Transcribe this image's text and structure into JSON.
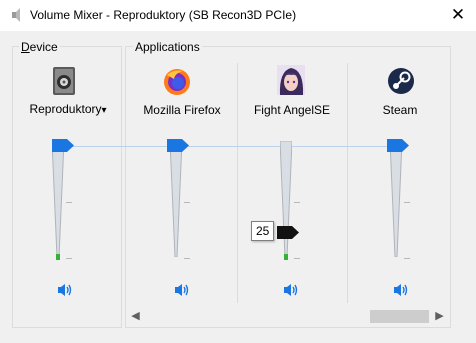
{
  "window": {
    "title": "Volume Mixer - Reproduktory (SB Recon3D PCIe)",
    "close_glyph": "✕",
    "icon": "speaker-icon"
  },
  "groups": {
    "device_label_first": "D",
    "device_label_rest": "evice",
    "applications_label": "Applications"
  },
  "channels": [
    {
      "label": "Reproduktory",
      "dropdown_glyph": "▾",
      "icon": "speaker-device-icon",
      "volume": 100,
      "thumb_color": "#1a76e1",
      "peak": 0.05
    },
    {
      "label": "Mozilla Firefox",
      "icon": "firefox-icon",
      "volume": 100,
      "thumb_color": "#1a76e1",
      "peak": 0
    },
    {
      "label": "Fight AngelSE",
      "icon": "fight-angel-icon",
      "volume": 25,
      "thumb_color": "#111111",
      "peak": 0.05,
      "tooltip": "25"
    },
    {
      "label": "Steam",
      "icon": "steam-icon",
      "volume": 100,
      "thumb_color": "#1a76e1",
      "peak": 0
    }
  ],
  "scrollbar": {
    "left_glyph": "◀",
    "right_glyph": "▶",
    "thumb_fraction": 0.24
  }
}
